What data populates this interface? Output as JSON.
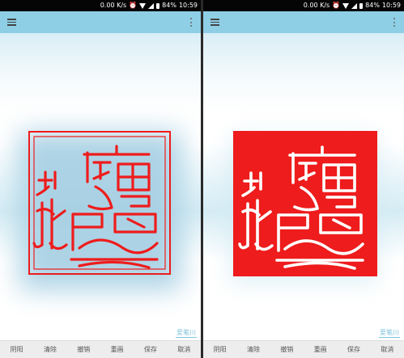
{
  "statusbar": {
    "speed": "0.00 K/s",
    "battery": "84%",
    "time": "10:59"
  },
  "watermark": "爱笔川",
  "seal_text": "菊花庵",
  "colors": {
    "seal_red": "#ee1c1c",
    "toolbar_blue": "#8ecfe6"
  },
  "toolbar": {
    "left_icon": "menu-icon",
    "right_icon": "more-icon"
  },
  "bottom_bar": {
    "items": [
      "阴阳",
      "清除",
      "撤销",
      "重画",
      "保存",
      "取消"
    ]
  }
}
